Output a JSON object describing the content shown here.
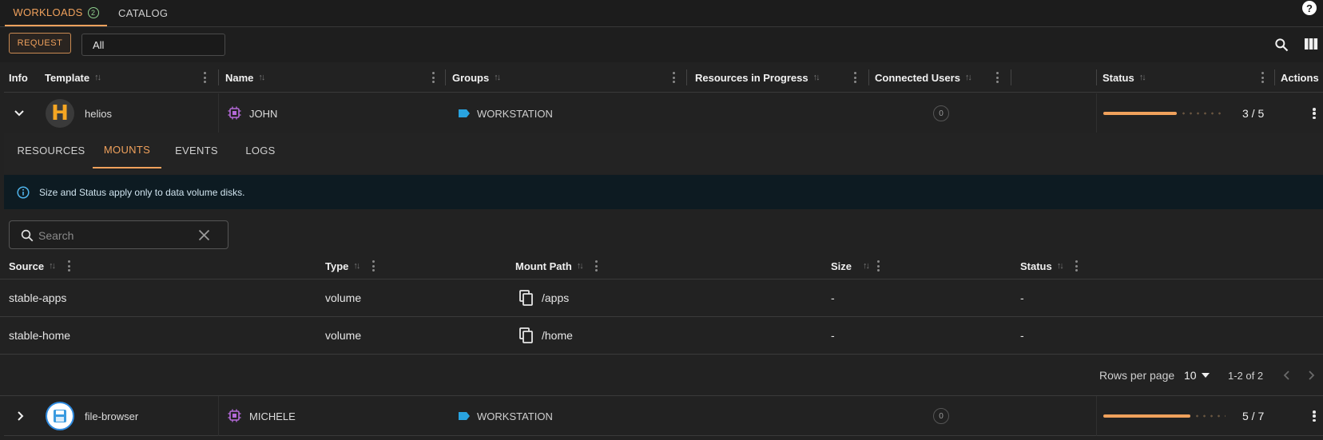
{
  "top_tabs": [
    {
      "label": "WORKLOADS",
      "badge": "2",
      "active": true
    },
    {
      "label": "CATALOG",
      "active": false
    }
  ],
  "help_label": "?",
  "toolbar": {
    "request_label": "REQUEST",
    "filter_value": "All"
  },
  "table": {
    "headers": {
      "info": "Info",
      "template": "Template",
      "name": "Name",
      "groups": "Groups",
      "resources": "Resources in Progress",
      "connected_users": "Connected Users",
      "status": "Status",
      "actions": "Actions"
    },
    "rows": [
      {
        "template": "helios",
        "avatar_letter": "H",
        "name": "JOHN",
        "group": "WORKSTATION",
        "connected_users": "0",
        "status_text": "3 / 5",
        "progress": 0.6,
        "expanded": true
      },
      {
        "template": "file-browser",
        "name": "MICHELE",
        "group": "WORKSTATION",
        "connected_users": "0",
        "status_text": "5 / 7",
        "progress": 0.714,
        "expanded": false
      }
    ]
  },
  "details": {
    "tabs": [
      {
        "label": "RESOURCES",
        "active": false
      },
      {
        "label": "MOUNTS",
        "active": true
      },
      {
        "label": "EVENTS",
        "active": false
      },
      {
        "label": "LOGS",
        "active": false
      }
    ],
    "info_message": "Size and Status apply only to data volume disks.",
    "search_placeholder": "Search",
    "mount_headers": {
      "source": "Source",
      "type": "Type",
      "mount_path": "Mount Path",
      "size": "Size",
      "status": "Status"
    },
    "mounts": [
      {
        "source": "stable-apps",
        "type": "volume",
        "path": "/apps",
        "size": "-",
        "status": "-"
      },
      {
        "source": "stable-home",
        "type": "volume",
        "path": "/home",
        "size": "-",
        "status": "-"
      }
    ],
    "pagination": {
      "rows_per_page_label": "Rows per page",
      "rows_per_page": "10",
      "range": "1-2 of 2"
    }
  },
  "colors": {
    "accent": "#f0a15c",
    "tag_blue": "#29a3e0",
    "chip_purple": "#b46ad8",
    "background": "#222222"
  }
}
